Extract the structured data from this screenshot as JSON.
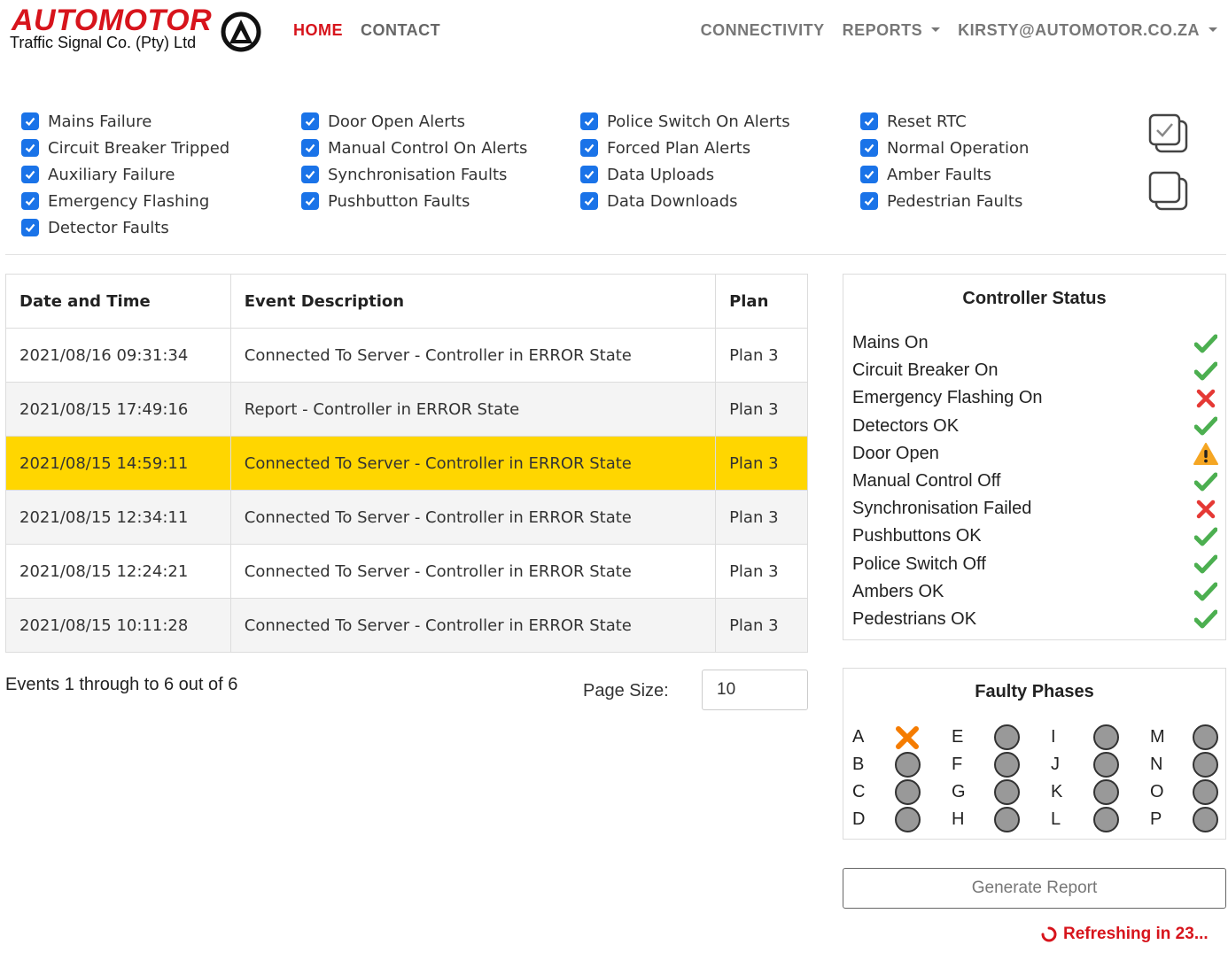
{
  "brand": {
    "name": "AUTOMOTOR",
    "tagline": "Traffic Signal Co. (Pty) Ltd",
    "logo_color": "#d7141c"
  },
  "nav": {
    "left": [
      "HOME",
      "CONTACT"
    ],
    "right": [
      {
        "label": "CONNECTIVITY",
        "dropdown": false
      },
      {
        "label": "REPORTS",
        "dropdown": true
      },
      {
        "label": "KIRSTY@AUTOMOTOR.CO.ZA",
        "dropdown": true
      }
    ]
  },
  "filters": {
    "columns": [
      [
        "Mains Failure",
        "Circuit Breaker Tripped",
        "Auxiliary Failure",
        "Emergency Flashing",
        "Detector Faults"
      ],
      [
        "Door Open Alerts",
        "Manual Control On Alerts",
        "Synchronisation Faults",
        "Pushbutton Faults"
      ],
      [
        "Police Switch On Alerts",
        "Forced Plan Alerts",
        "Data Uploads",
        "Data Downloads"
      ],
      [
        "Reset RTC",
        "Normal Operation",
        "Amber Faults",
        "Pedestrian Faults"
      ]
    ],
    "checked": true,
    "check_color": "#1a73e8",
    "bulk_actions": [
      "select-all-icon",
      "deselect-all-icon"
    ]
  },
  "events": {
    "headers": [
      "Date and Time",
      "Event Description",
      "Plan"
    ],
    "rows": [
      {
        "datetime": "2021/08/16 09:31:34",
        "description": "Connected To Server - Controller in ERROR State",
        "plan": "Plan 3"
      },
      {
        "datetime": "2021/08/15 17:49:16",
        "description": "Report - Controller in ERROR State",
        "plan": "Plan 3"
      },
      {
        "datetime": "2021/08/15 14:59:11",
        "description": "Connected To Server - Controller in ERROR State",
        "plan": "Plan 3",
        "highlighted": true
      },
      {
        "datetime": "2021/08/15 12:34:11",
        "description": "Connected To Server - Controller in ERROR State",
        "plan": "Plan 3"
      },
      {
        "datetime": "2021/08/15 12:24:21",
        "description": "Connected To Server - Controller in ERROR State",
        "plan": "Plan 3"
      },
      {
        "datetime": "2021/08/15 10:11:28",
        "description": "Connected To Server - Controller in ERROR State",
        "plan": "Plan 3"
      }
    ],
    "highlight_color": "#ffd600",
    "count_text": "Events 1 through to 6 out of 6",
    "page_size_label": "Page Size:",
    "page_size_value": "10"
  },
  "controller_status": {
    "title": "Controller Status",
    "items": [
      {
        "label": "Mains On",
        "status": "ok"
      },
      {
        "label": "Circuit Breaker On",
        "status": "ok"
      },
      {
        "label": "Emergency Flashing On",
        "status": "error"
      },
      {
        "label": "Detectors OK",
        "status": "ok"
      },
      {
        "label": "Door Open",
        "status": "warning"
      },
      {
        "label": "Manual Control Off",
        "status": "ok"
      },
      {
        "label": "Synchronisation Failed",
        "status": "error"
      },
      {
        "label": "Pushbuttons OK",
        "status": "ok"
      },
      {
        "label": "Police Switch Off",
        "status": "ok"
      },
      {
        "label": "Ambers OK",
        "status": "ok"
      },
      {
        "label": "Pedestrians OK",
        "status": "ok"
      }
    ],
    "colors": {
      "ok": "#4caf50",
      "error": "#e53935",
      "warning": "#f5a623"
    }
  },
  "faulty_phases": {
    "title": "Faulty Phases",
    "columns": [
      [
        {
          "label": "A",
          "faulty": true
        },
        {
          "label": "B",
          "faulty": false
        },
        {
          "label": "C",
          "faulty": false
        },
        {
          "label": "D",
          "faulty": false
        }
      ],
      [
        {
          "label": "E",
          "faulty": false
        },
        {
          "label": "F",
          "faulty": false
        },
        {
          "label": "G",
          "faulty": false
        },
        {
          "label": "H",
          "faulty": false
        }
      ],
      [
        {
          "label": "I",
          "faulty": false
        },
        {
          "label": "J",
          "faulty": false
        },
        {
          "label": "K",
          "faulty": false
        },
        {
          "label": "L",
          "faulty": false
        }
      ],
      [
        {
          "label": "M",
          "faulty": false
        },
        {
          "label": "N",
          "faulty": false
        },
        {
          "label": "O",
          "faulty": false
        },
        {
          "label": "P",
          "faulty": false
        }
      ]
    ],
    "fault_color": "#f57c00"
  },
  "actions": {
    "generate_report": "Generate Report",
    "refresh_text": "Refreshing in 23..."
  }
}
